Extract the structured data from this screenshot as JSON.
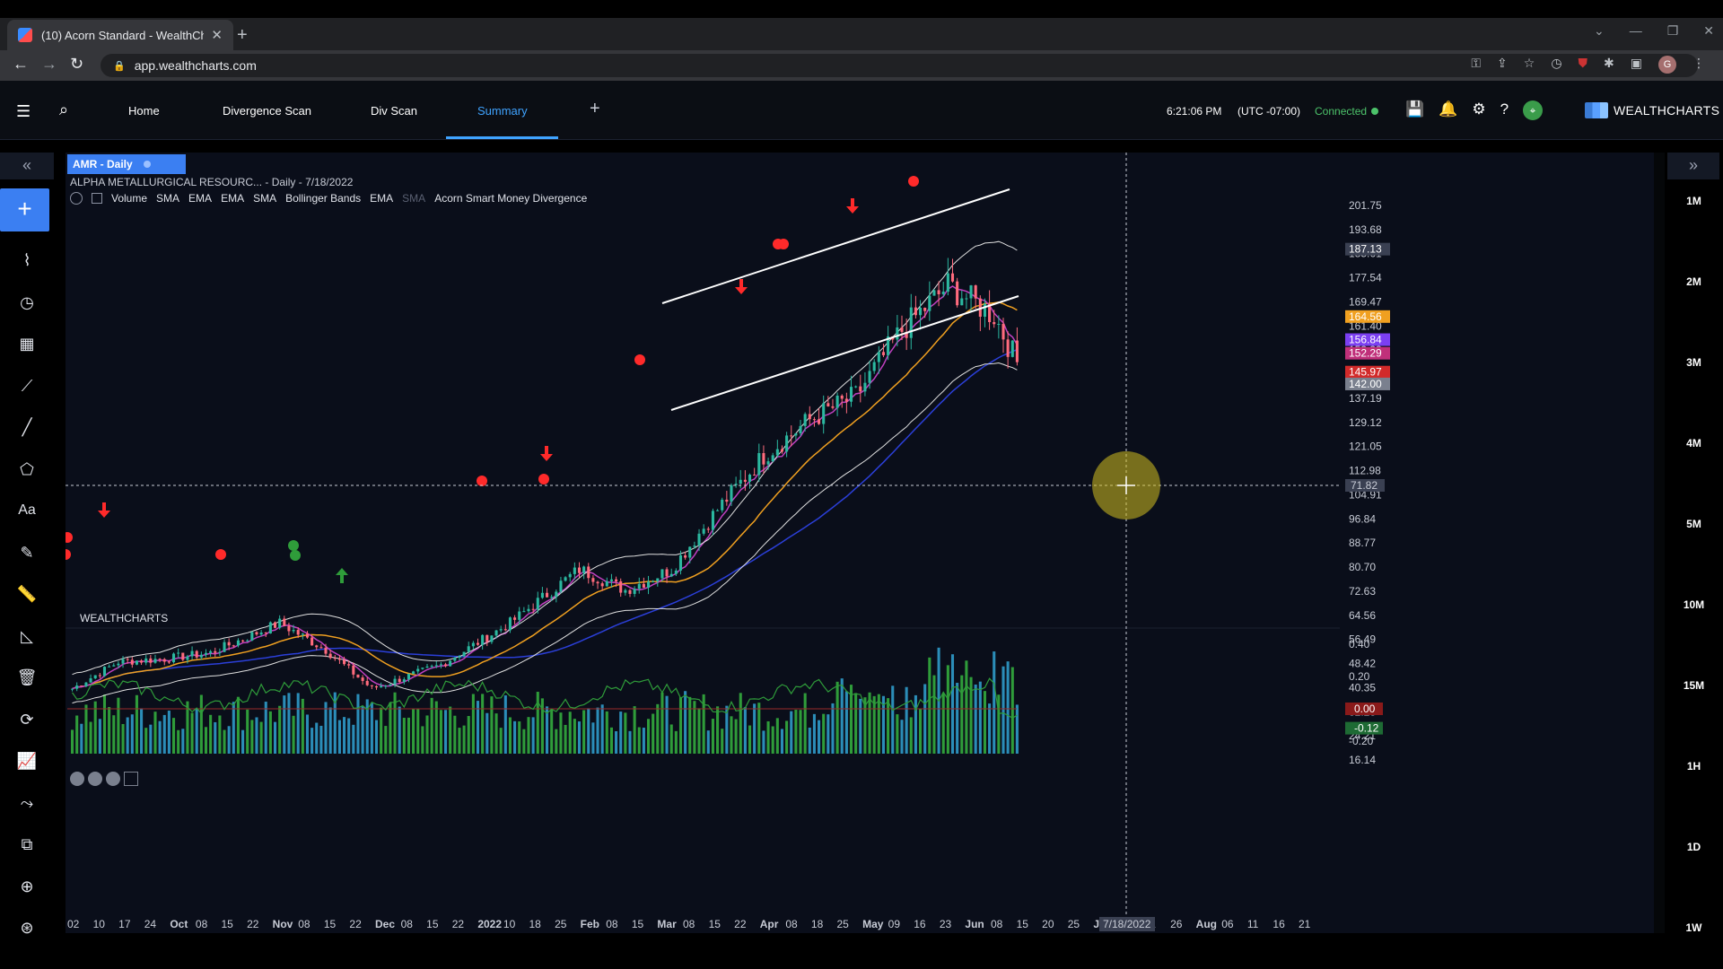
{
  "browser": {
    "tab_title": "(10) Acorn Standard - WealthCha",
    "url": "app.wealthcharts.com"
  },
  "header": {
    "nav": [
      "Home",
      "Divergence Scan",
      "Div Scan",
      "Summary"
    ],
    "active_nav": "Summary",
    "time": "6:21:06 PM",
    "timezone": "(UTC -07:00)",
    "connection_status": "Connected",
    "brand": "WEALTHCHARTS"
  },
  "chart": {
    "tab_label": "AMR - Daily",
    "symbol_name": "ALPHA METALLURGICAL RESOURC...",
    "interval_date": "- Daily - 7/18/2022",
    "indicators": [
      "Volume",
      "SMA",
      "EMA",
      "EMA",
      "SMA",
      "Bollinger Bands",
      "EMA",
      "SMA",
      "Acorn Smart Money Divergence"
    ],
    "watermark": "WEALTHCHARTS",
    "price_axis": [
      "201.75",
      "193.68",
      "185.61",
      "177.54",
      "169.47",
      "161.40",
      "153.33",
      "145.26",
      "137.19",
      "129.12",
      "121.05",
      "112.98",
      "104.91",
      "96.84",
      "88.77",
      "80.70",
      "72.63",
      "64.56",
      "56.49",
      "48.42",
      "40.35",
      "32.28",
      "24.21",
      "16.14"
    ],
    "price_badges": [
      {
        "label": "187.13",
        "value": 187.13,
        "color": "#3a4052"
      },
      {
        "label": "164.56",
        "value": 164.56,
        "color": "#f0a020"
      },
      {
        "label": "156.84",
        "value": 156.84,
        "color": "#7b3ff2"
      },
      {
        "label": "152.29",
        "value": 152.29,
        "color": "#c0307a"
      },
      {
        "label": "145.97",
        "value": 145.97,
        "color": "#d22a2a"
      },
      {
        "label": "142.00",
        "value": 142.0,
        "color": "#7a808e"
      }
    ],
    "crosshair_price": "71.82",
    "crosshair_date": "7/18/2022",
    "osc_axis": [
      "0.40",
      "0.20",
      "0.00",
      "-0.12",
      "-0.20"
    ],
    "osc_badges": [
      {
        "label": "0.00",
        "color": "#8a1a1a"
      },
      {
        "label": "-0.12",
        "color": "#1e6b34"
      }
    ],
    "x_axis": [
      "02",
      "10",
      "17",
      "24",
      "Oct",
      "08",
      "15",
      "22",
      "Nov",
      "08",
      "15",
      "22",
      "Dec",
      "08",
      "15",
      "22",
      "2022",
      "10",
      "18",
      "25",
      "Feb",
      "08",
      "15",
      "Mar",
      "08",
      "15",
      "22",
      "Apr",
      "08",
      "18",
      "25",
      "May",
      "09",
      "16",
      "23",
      "Jun",
      "08",
      "15",
      "20",
      "25",
      "Jul",
      "06",
      "11",
      "26",
      "Aug",
      "06",
      "11",
      "16",
      "21"
    ],
    "bold_x_labels": [
      "Oct",
      "Nov",
      "Dec",
      "2022",
      "Feb",
      "Mar",
      "Apr",
      "May",
      "Jun",
      "Jul",
      "Aug"
    ],
    "colors": {
      "up": "#2bb8a0",
      "down": "#ff6b7d",
      "vol_up": "#2f9c3a",
      "vol_down": "#2b8db8",
      "sma_fast": "#c040c0",
      "ema_orange": "#f0a020",
      "sma_blue": "#2b3fd8",
      "bollinger": "#e0e0e0",
      "trendline": "#ffffff",
      "signal": "#ff2a2a",
      "bull_signal": "#2f9c3a"
    }
  },
  "timeframes": [
    "1M",
    "2M",
    "3M",
    "4M",
    "5M",
    "10M",
    "15M",
    "1H",
    "1D",
    "1W"
  ]
}
